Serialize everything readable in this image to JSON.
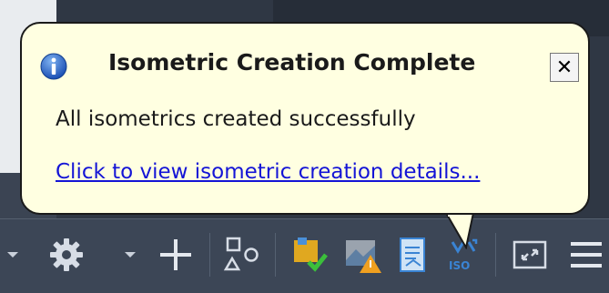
{
  "notification": {
    "title": "Isometric Creation Complete",
    "message": "All isometrics created successfully",
    "link_text": "Click to view isometric creation details...",
    "close_symbol": "✕",
    "icon": "info-icon"
  },
  "toolbar": {
    "items": [
      {
        "name": "dropdown-arrow-icon"
      },
      {
        "name": "gear-icon"
      },
      {
        "name": "dropdown-arrow-icon"
      },
      {
        "name": "plus-icon"
      },
      {
        "name": "shapes-icon"
      },
      {
        "name": "project-check-icon"
      },
      {
        "name": "warning-image-icon"
      },
      {
        "name": "document-icon"
      },
      {
        "name": "iso-icon",
        "label": "ISO"
      },
      {
        "name": "fullscreen-icon"
      },
      {
        "name": "menu-icon"
      }
    ]
  },
  "colors": {
    "balloon_bg": "#ffffe1",
    "link": "#1414d6",
    "status_bar": "#3c4656"
  }
}
